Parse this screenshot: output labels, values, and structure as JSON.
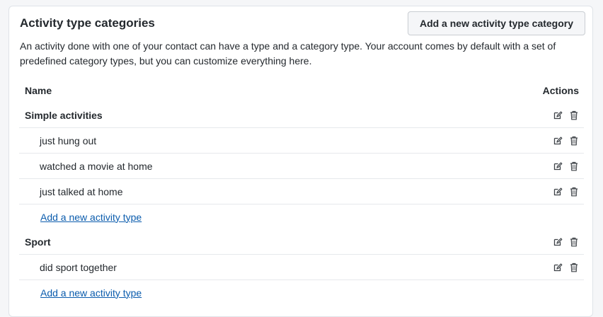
{
  "card": {
    "title": "Activity type categories",
    "add_category_button": "Add a new activity type category",
    "description": "An activity done with one of your contact can have a type and a category type. Your account comes by default with a set of predefined category types, but you can customize everything here."
  },
  "table": {
    "col_name": "Name",
    "col_actions": "Actions"
  },
  "categories": [
    {
      "name": "Simple activities",
      "types": [
        "just hung out",
        "watched a movie at home",
        "just talked at home"
      ],
      "add_type_link": "Add a new activity type"
    },
    {
      "name": "Sport",
      "types": [
        "did sport together"
      ],
      "add_type_link": "Add a new activity type"
    }
  ],
  "icons": {
    "edit": "edit-icon",
    "delete": "trash-icon"
  },
  "colors": {
    "link": "#0b5cad",
    "border": "#e6e9ec"
  }
}
